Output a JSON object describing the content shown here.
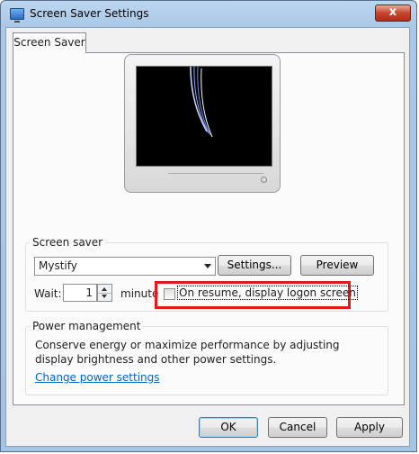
{
  "window": {
    "title": "Screen Saver Settings",
    "close_label": "x"
  },
  "tabs": [
    {
      "label": "Screen Saver"
    }
  ],
  "screen_saver": {
    "group_label": "Screen saver",
    "selected": "Mystify",
    "settings_button": "Settings...",
    "preview_button": "Preview",
    "wait_label": "Wait:",
    "wait_value": "1",
    "minutes_label": "minute",
    "logon_checkbox_label": "On resume, display logon screen",
    "logon_checked": false
  },
  "power": {
    "group_label": "Power management",
    "description": "Conserve energy or maximize performance by adjusting display brightness and other power settings.",
    "link": "Change power settings"
  },
  "footer": {
    "ok": "OK",
    "cancel": "Cancel",
    "apply": "Apply"
  },
  "colors": {
    "highlight_box": "#e01b1b",
    "link": "#0066cc"
  }
}
